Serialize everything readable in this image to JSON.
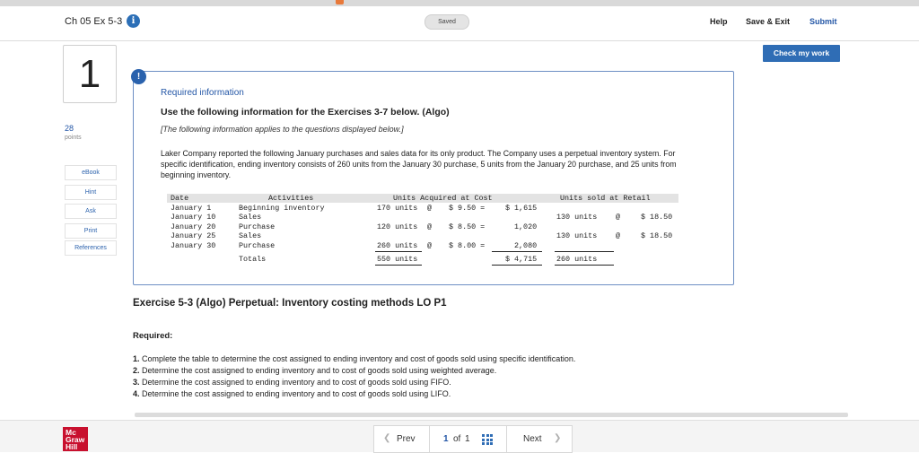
{
  "header": {
    "title": "Ch 05 Ex 5-3",
    "info_icon": "i",
    "saved": "Saved",
    "help": "Help",
    "save_exit": "Save & Exit",
    "submit": "Submit"
  },
  "check_my_work": "Check my work",
  "question": {
    "number": "1",
    "points_value": "28",
    "points_label": "points"
  },
  "sidebar": {
    "items": [
      {
        "label": "eBook"
      },
      {
        "label": "Hint"
      },
      {
        "label": "Ask"
      },
      {
        "label": "Print"
      },
      {
        "label": "References"
      }
    ]
  },
  "info": {
    "alert_icon": "!",
    "heading": "Required information",
    "use_line": "Use the following information for the Exercises 3-7 below. (Algo)",
    "applies": "[The following information applies to the questions displayed below.]",
    "paragraph": "Laker Company reported the following January purchases and sales data for its only product. The Company uses a perpetual inventory system. For specific identification, ending inventory consists of 260 units from the January 30 purchase, 5 units from the January 20 purchase, and 25 units from beginning inventory."
  },
  "table": {
    "headers": {
      "date": "Date",
      "activities": "Activities",
      "acquired": "Units Acquired at Cost",
      "sold": "Units sold at Retail"
    },
    "rows": [
      {
        "date": "January 1",
        "activity": "Beginning inventory",
        "units": "170 units",
        "at": "@",
        "cost": "$ 9.50 =",
        "total": "$ 1,615",
        "sold": "",
        "sold_at": "",
        "retail": ""
      },
      {
        "date": "January 10",
        "activity": "Sales",
        "units": "",
        "at": "",
        "cost": "",
        "total": "",
        "sold": "130 units",
        "sold_at": "@",
        "retail": "$ 18.50"
      },
      {
        "date": "January 20",
        "activity": "Purchase",
        "units": "120 units",
        "at": "@",
        "cost": "$ 8.50 =",
        "total": "1,020",
        "sold": "",
        "sold_at": "",
        "retail": ""
      },
      {
        "date": "January 25",
        "activity": "Sales",
        "units": "",
        "at": "",
        "cost": "",
        "total": "",
        "sold": "130 units",
        "sold_at": "@",
        "retail": "$ 18.50"
      },
      {
        "date": "January 30",
        "activity": "Purchase",
        "units": "260 units",
        "at": "@",
        "cost": "$ 8.00 =",
        "total": "2,080",
        "sold": "",
        "sold_at": "",
        "retail": ""
      }
    ],
    "totals": {
      "label": "Totals",
      "units": "550 units",
      "cost": "$ 4,715",
      "sold": "260 units"
    }
  },
  "exercise": {
    "title": "Exercise 5-3 (Algo) Perpetual: Inventory costing methods LO P1",
    "required_label": "Required:",
    "items": [
      {
        "num": "1.",
        "text": "Complete the table to determine the cost assigned to ending inventory and cost of goods sold using specific identification."
      },
      {
        "num": "2.",
        "text": "Determine the cost assigned to ending inventory and to cost of goods sold using weighted average."
      },
      {
        "num": "3.",
        "text": "Determine the cost assigned to ending inventory and to cost of goods sold using FIFO."
      },
      {
        "num": "4.",
        "text": "Determine the cost assigned to ending inventory and to cost of goods sold using LIFO."
      }
    ]
  },
  "footer": {
    "logo_lines": [
      "Mc",
      "Graw",
      "Hill"
    ],
    "prev": "Prev",
    "page_current": "1",
    "page_of": "of",
    "page_total": "1",
    "next": "Next",
    "prev_icon": "chevron-left-icon",
    "next_icon": "chevron-right-icon",
    "grid_icon": "grid-icon"
  },
  "colors": {
    "accent": "#2f6db5",
    "link": "#2356a6",
    "brand": "#c8102e"
  }
}
